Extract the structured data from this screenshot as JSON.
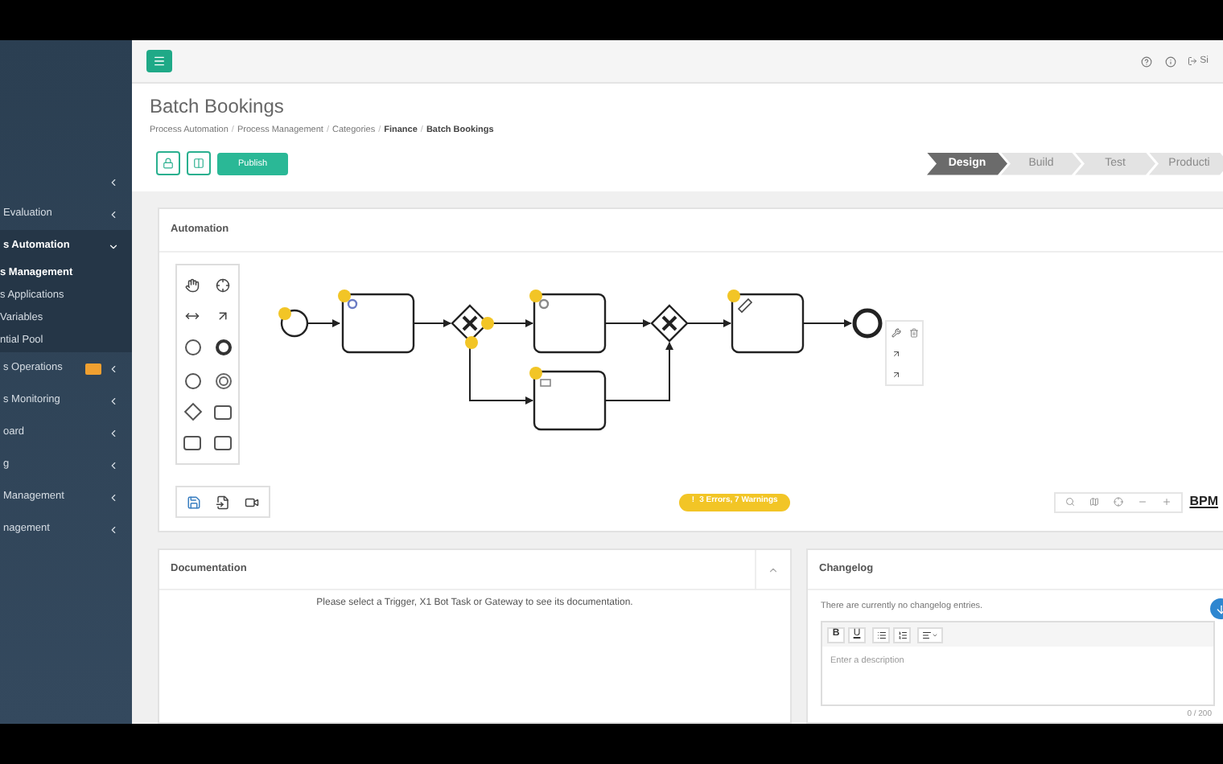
{
  "sidebar": {
    "items": [
      {
        "label": "Evaluation",
        "expanded": false
      },
      {
        "label": "s Automation",
        "expanded": true,
        "children": [
          {
            "label": "s Management",
            "selected": true
          },
          {
            "label": "s Applications",
            "selected": false
          },
          {
            "label": "Variables",
            "selected": false
          },
          {
            "label": "ntial Pool",
            "selected": false
          }
        ]
      },
      {
        "label": "s Operations",
        "expanded": false,
        "badge": true
      },
      {
        "label": "s Monitoring",
        "expanded": false
      },
      {
        "label": "oard",
        "expanded": false
      },
      {
        "label": "g",
        "expanded": false
      },
      {
        "label": "Management",
        "expanded": false
      },
      {
        "label": "nagement",
        "expanded": false
      }
    ]
  },
  "header": {
    "user_link": "Si"
  },
  "page": {
    "title": "Batch Bookings",
    "breadcrumb": [
      {
        "label": "Process Automation",
        "current": false
      },
      {
        "label": "Process Management",
        "current": false
      },
      {
        "label": "Categories",
        "current": false
      },
      {
        "label": "Finance",
        "current": true
      },
      {
        "label": "Batch Bookings",
        "current": true
      }
    ],
    "breadcrumb_separator": "/",
    "publish_button": "Publish"
  },
  "stepper": [
    {
      "label": "Design",
      "selected": true
    },
    {
      "label": "Build",
      "selected": false
    },
    {
      "label": "Test",
      "selected": false
    },
    {
      "label": "Producti",
      "selected": false
    }
  ],
  "automation": {
    "title": "Automation",
    "issues": "3 Errors, 7 Warnings",
    "issue_icon": "!",
    "watermark": "BPM"
  },
  "documentation": {
    "title": "Documentation",
    "message": "Please select a Trigger, X1 Bot Task or Gateway to see its documentation."
  },
  "changelog": {
    "title": "Changelog",
    "message": "There are currently no changelog entries.",
    "toolbar": [
      "B",
      "U"
    ],
    "placeholder": "Enter a description",
    "counter": "0 / 200"
  }
}
